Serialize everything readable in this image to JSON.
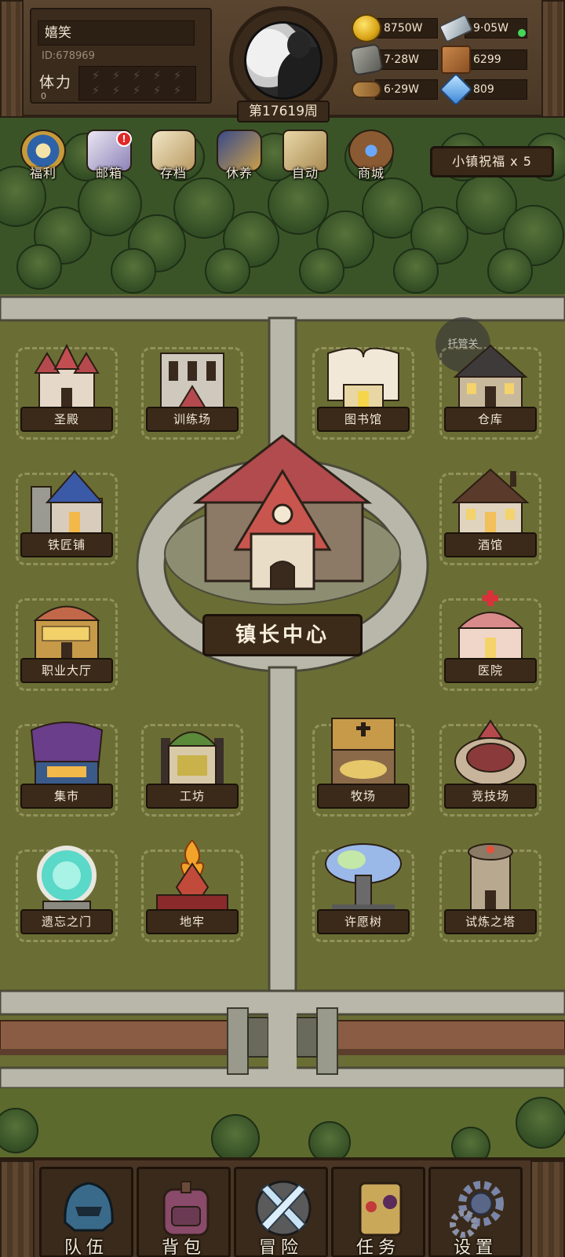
{
  "player": {
    "name": "嬉笑",
    "id": "ID:678969",
    "stamina_label": "体力",
    "stamina_value": "0",
    "week": "第17619周"
  },
  "resources": {
    "gold": "8750W",
    "ingot": "9·05W",
    "ore": "7·28W",
    "leather": "6299",
    "wood": "6·29W",
    "crystal": "809"
  },
  "menu": {
    "items": [
      {
        "label": "福利",
        "icon": "shield-badge-icon"
      },
      {
        "label": "邮箱",
        "icon": "mail-icon",
        "badge": "!"
      },
      {
        "label": "存档",
        "icon": "scroll-quill-icon"
      },
      {
        "label": "休养",
        "icon": "scroll-rest-icon"
      },
      {
        "label": "自动",
        "icon": "map-icon"
      },
      {
        "label": "商城",
        "icon": "shop-icon"
      }
    ],
    "blessing": "小镇祝福 x 5",
    "managed": "托管关"
  },
  "buildings": {
    "shrine": "圣殿",
    "training": "训练场",
    "library": "图书馆",
    "warehouse": "仓库",
    "smithy": "铁匠铺",
    "tavern": "酒馆",
    "job_hall": "职业大厅",
    "hospital": "医院",
    "market": "集市",
    "workshop": "工坊",
    "ranch": "牧场",
    "arena": "竞技场",
    "gate": "遗忘之门",
    "dungeon": "地牢",
    "wish_tree": "许愿树",
    "trial_tower": "试炼之塔",
    "center": "镇长中心"
  },
  "nav": {
    "team": "队伍",
    "bag": "背包",
    "adventure": "冒险",
    "quest": "任务",
    "settings": "设置"
  },
  "colors": {
    "grass": "#6b6e34",
    "path": "#b8b7aa",
    "wood": "#4a3826",
    "sign": "#3b2a1a",
    "text": "#f3ead6",
    "online": "#44d65b",
    "badge": "#e12828"
  }
}
